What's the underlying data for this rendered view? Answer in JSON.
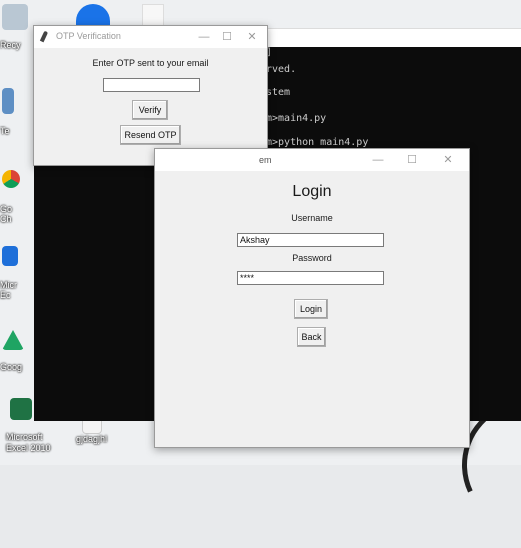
{
  "desktop": {
    "icons": [
      {
        "label": "Recy"
      },
      {
        "label": "Te"
      },
      {
        "label": "Go\nCh"
      },
      {
        "label": "Micr\nEc"
      },
      {
        "label": "Goog"
      },
      {
        "label": "Microsoft\nExcel 2010"
      },
      {
        "label": "gjdagjhl"
      }
    ]
  },
  "console": {
    "lines": [
      "]",
      "rved.",
      "stem",
      "m>main4.py",
      "m>python main4.py"
    ]
  },
  "otp_window": {
    "title": "OTP Verification",
    "prompt": "Enter OTP sent to your email",
    "otp_value": "",
    "verify_label": "Verify",
    "resend_label": "Resend OTP",
    "controls": {
      "minimize": "—",
      "maximize": "☐",
      "close": "✕"
    }
  },
  "login_window": {
    "title": "em",
    "heading": "Login",
    "username_label": "Username",
    "username_value": "Akshay",
    "password_label": "Password",
    "password_value": "****",
    "login_label": "Login",
    "back_label": "Back",
    "controls": {
      "minimize": "—",
      "maximize": "☐",
      "close": "✕"
    }
  }
}
